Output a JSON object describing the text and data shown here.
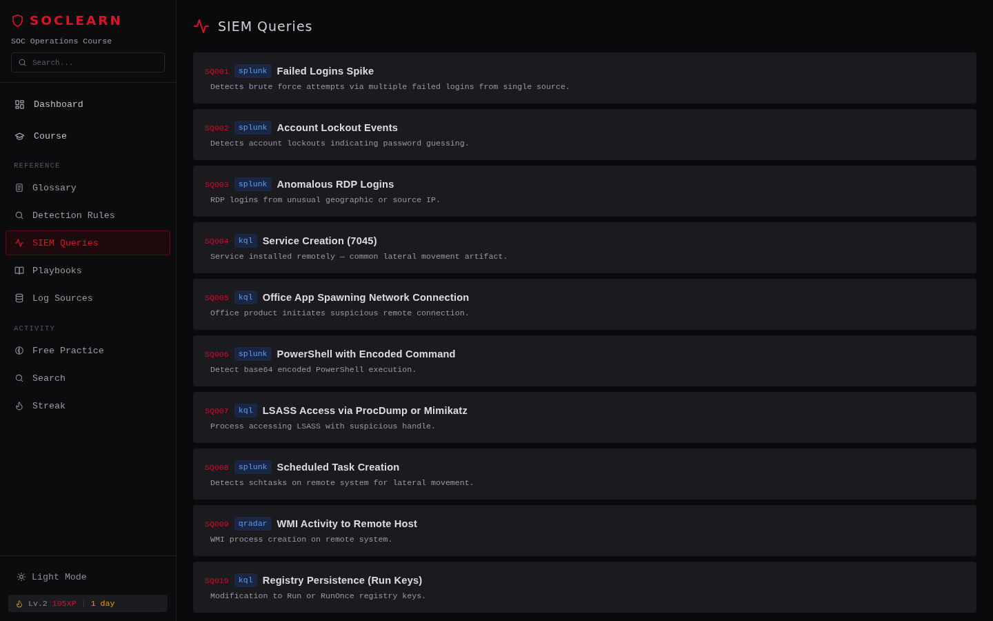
{
  "sidebar": {
    "logo": "SOCLEARN",
    "subtitle": "SOC Operations Course",
    "search": {
      "placeholder": "Search..."
    },
    "main_nav": [
      {
        "label": "Dashboard",
        "selected": false
      },
      {
        "label": "Course",
        "selected": false
      }
    ],
    "sections": [
      {
        "title": "REFERENCE",
        "items": [
          {
            "label": "Glossary",
            "selected": false
          },
          {
            "label": "Detection Rules",
            "selected": false
          },
          {
            "label": "SIEM Queries",
            "selected": true
          },
          {
            "label": "Playbooks",
            "selected": false
          },
          {
            "label": "Log Sources",
            "selected": false
          }
        ]
      },
      {
        "title": "ACTIVITY",
        "items": [
          {
            "label": "Free Practice",
            "selected": false
          },
          {
            "label": "Search",
            "selected": false
          },
          {
            "label": "Streak",
            "selected": false
          }
        ]
      }
    ],
    "theme_toggle": {
      "label": "Light Mode"
    },
    "status": {
      "rank": "Lv.2",
      "xp": "105XP",
      "streak": "1 day"
    }
  },
  "page": {
    "title": "SIEM Queries"
  },
  "queries": [
    {
      "id": "SQ001",
      "language": "splunk",
      "title": "Failed Logins Spike",
      "description": "Detects brute force attempts via multiple failed logins from single source."
    },
    {
      "id": "SQ002",
      "language": "splunk",
      "title": "Account Lockout Events",
      "description": "Detects account lockouts indicating password guessing."
    },
    {
      "id": "SQ003",
      "language": "splunk",
      "title": "Anomalous RDP Logins",
      "description": "RDP logins from unusual geographic or source IP."
    },
    {
      "id": "SQ004",
      "language": "kql",
      "title": "Service Creation (7045)",
      "description": "Service installed remotely — common lateral movement artifact."
    },
    {
      "id": "SQ005",
      "language": "kql",
      "title": "Office App Spawning Network Connection",
      "description": "Office product initiates suspicious remote connection."
    },
    {
      "id": "SQ006",
      "language": "splunk",
      "title": "PowerShell with Encoded Command",
      "description": "Detect base64 encoded PowerShell execution."
    },
    {
      "id": "SQ007",
      "language": "kql",
      "title": "LSASS Access via ProcDump or Mimikatz",
      "description": "Process accessing LSASS with suspicious handle."
    },
    {
      "id": "SQ008",
      "language": "splunk",
      "title": "Scheduled Task Creation",
      "description": "Detects schtasks on remote system for lateral movement."
    },
    {
      "id": "SQ009",
      "language": "qradar",
      "title": "WMI Activity to Remote Host",
      "description": "WMI process creation on remote system."
    },
    {
      "id": "SQ010",
      "language": "kql",
      "title": "Registry Persistence (Run Keys)",
      "description": "Modification to Run or RunOnce registry keys."
    }
  ]
}
